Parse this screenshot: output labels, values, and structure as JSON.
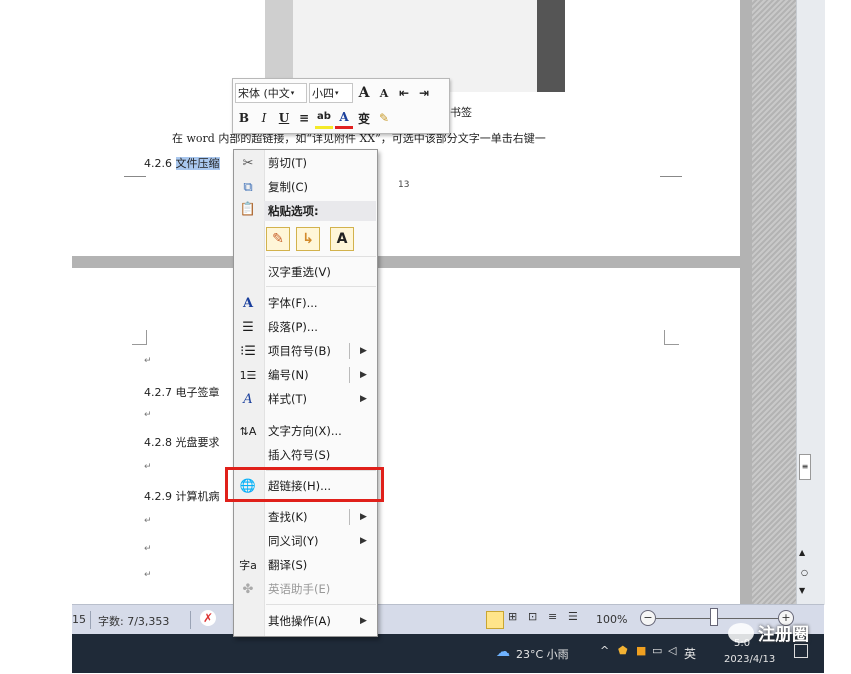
{
  "document": {
    "body_line": "在 word 内部的超链接，如“详见附件 XX”，可选中该部分文字一单击右键一",
    "bookmark_fragment": "书签",
    "heading_426_prefix": "4.2.6 ",
    "heading_426_selected": "文件压缩",
    "page_number": "13",
    "heading_427": "4.2.7 电子签章",
    "heading_428": "4.2.8 光盘要求",
    "heading_429": "4.2.9 计算机病",
    "para_mark": "↵"
  },
  "mini_toolbar": {
    "font_name": "宋体 (中文",
    "font_size": "小四",
    "grow_font": "A",
    "shrink_font": "A",
    "bold": "B",
    "italic": "I",
    "underline": "U",
    "font_color": "A",
    "phonetic": "变"
  },
  "context_menu": {
    "cut": "剪切(T)",
    "copy": "复制(C)",
    "paste_options": "粘贴选项:",
    "paste_text_only": "A",
    "reconvert": "汉字重选(V)",
    "font": "字体(F)...",
    "paragraph": "段落(P)...",
    "bullets": "项目符号(B)",
    "numbering": "编号(N)",
    "styles": "样式(T)",
    "text_direction": "文字方向(X)...",
    "insert_symbol": "插入符号(S)",
    "hyperlink": "超链接(H)...",
    "find": "查找(K)",
    "synonyms": "同义词(Y)",
    "translate": "翻译(S)",
    "english_assistant": "英语助手(E)",
    "more_actions": "其他操作(A)",
    "submenu_arrow": "▶"
  },
  "status_bar": {
    "page_fragment": "15",
    "word_count": "字数: 7/3,353",
    "zoom": "100%",
    "zoom_out": "−",
    "zoom_in": "+"
  },
  "taskbar": {
    "weather": "23°C 小雨",
    "ime": "英",
    "date": "2023/4/13",
    "time_fragment": "5:0"
  },
  "watermark": {
    "text": "注册圈"
  },
  "colors": {
    "highlight_box": "#e0201a",
    "selection": "#a9c7ee",
    "taskbar": "#1f2a38",
    "status_bar": "#d6dbe9"
  }
}
